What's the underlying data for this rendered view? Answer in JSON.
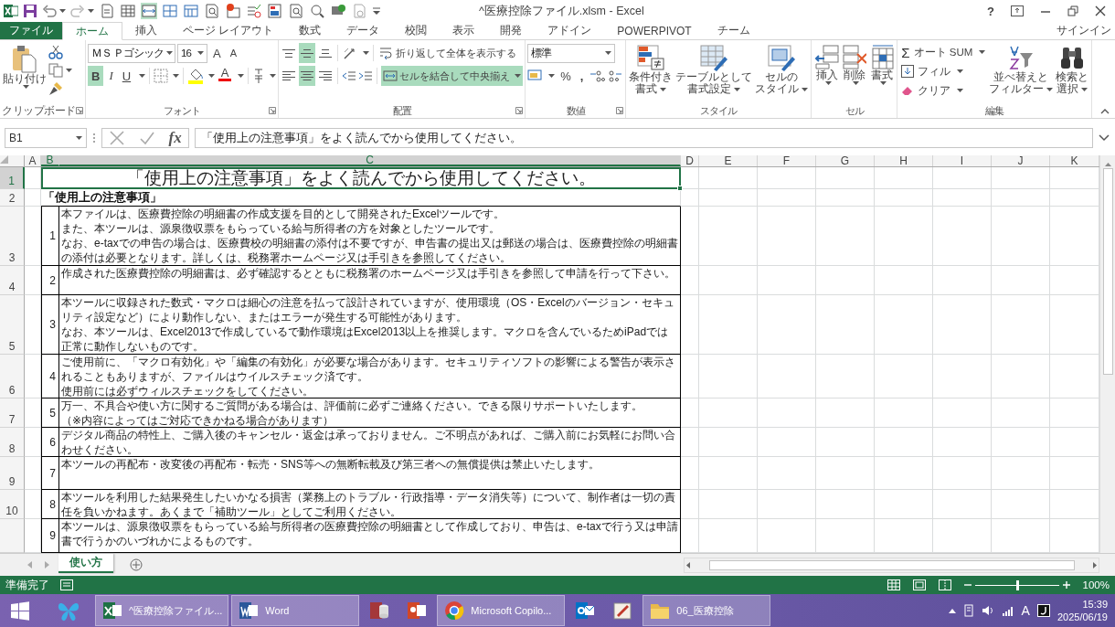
{
  "window": {
    "title": "^医療控除ファイル.xlsm - Excel",
    "help_label": "?"
  },
  "tabs": [
    {
      "label": "ファイル",
      "kind": "file",
      "selected": false
    },
    {
      "label": "ホーム",
      "kind": "tab",
      "selected": true
    },
    {
      "label": "挿入",
      "kind": "tab",
      "selected": false
    },
    {
      "label": "ページ レイアウト",
      "kind": "tab",
      "selected": false
    },
    {
      "label": "数式",
      "kind": "tab",
      "selected": false
    },
    {
      "label": "データ",
      "kind": "tab",
      "selected": false
    },
    {
      "label": "校閲",
      "kind": "tab",
      "selected": false
    },
    {
      "label": "表示",
      "kind": "tab",
      "selected": false
    },
    {
      "label": "開発",
      "kind": "tab",
      "selected": false
    },
    {
      "label": "アドイン",
      "kind": "tab",
      "selected": false
    },
    {
      "label": "POWERPIVOT",
      "kind": "tab",
      "selected": false
    },
    {
      "label": "チーム",
      "kind": "tab",
      "selected": false
    }
  ],
  "sign_in": "サインイン",
  "ribbon": {
    "clipboard": {
      "label": "クリップボード",
      "paste": "貼り付け"
    },
    "font": {
      "label": "フォント",
      "font_name": "ＭＳ Ｐゴシック",
      "font_size": "16",
      "grow_glyph": "A",
      "shrink_glyph": "A",
      "color_glyph": "A",
      "styles": [
        {
          "kind": "bold",
          "label": "B",
          "selected": true
        },
        {
          "kind": "italic",
          "label": "I",
          "selected": false
        },
        {
          "kind": "underline",
          "label": "U",
          "selected": false
        }
      ]
    },
    "alignment": {
      "label": "配置",
      "wrap": "折り返して全体を表示する",
      "merge": "セルを結合して中央揃え",
      "merge_selected": true,
      "vertical": [
        {
          "kind": "top",
          "selected": false
        },
        {
          "kind": "middle",
          "selected": true
        },
        {
          "kind": "bottom",
          "selected": false
        }
      ],
      "horizontal": [
        {
          "kind": "left",
          "selected": false
        },
        {
          "kind": "center",
          "selected": true
        },
        {
          "kind": "right",
          "selected": false
        }
      ]
    },
    "number": {
      "label": "数値",
      "format": "標準",
      "percent": "%",
      "comma": ","
    },
    "styles": {
      "label": "スタイル",
      "buttons": [
        {
          "kind": "conditional",
          "lines": [
            "条件付き",
            "書式"
          ]
        },
        {
          "kind": "table",
          "lines": [
            "テーブルとして",
            "書式設定"
          ]
        },
        {
          "kind": "cellstyle",
          "lines": [
            "セルの",
            "スタイル"
          ]
        }
      ]
    },
    "cells": {
      "label": "セル",
      "buttons": [
        {
          "kind": "insert",
          "label": "挿入"
        },
        {
          "kind": "delete",
          "label": "削除"
        },
        {
          "kind": "format",
          "label": "書式"
        }
      ]
    },
    "editing": {
      "label": "編集",
      "sigma": "Σ",
      "autosum": "オート SUM",
      "fill": "フィル",
      "clear": "クリア",
      "sort": [
        "並べ替えと",
        "フィルター"
      ],
      "find": [
        "検索と",
        "選択"
      ]
    }
  },
  "formula_bar": {
    "name_box": "B1",
    "fx": "fx",
    "formula": "「使用上の注意事項」をよく読んでから使用してください。"
  },
  "columns": [
    {
      "label": "A",
      "selected": false
    },
    {
      "label": "B",
      "selected": true
    },
    {
      "label": "C",
      "selected": true
    },
    {
      "label": "D",
      "selected": false
    },
    {
      "label": "E",
      "selected": false
    },
    {
      "label": "F",
      "selected": false
    },
    {
      "label": "G",
      "selected": false
    },
    {
      "label": "H",
      "selected": false
    },
    {
      "label": "I",
      "selected": false
    },
    {
      "label": "J",
      "selected": false
    },
    {
      "label": "K",
      "selected": false
    }
  ],
  "rows": [
    {
      "number": "1",
      "selected": true
    },
    {
      "number": "2",
      "selected": false
    },
    {
      "number": "3",
      "selected": false
    },
    {
      "number": "4",
      "selected": false
    },
    {
      "number": "5",
      "selected": false
    },
    {
      "number": "6",
      "selected": false
    },
    {
      "number": "7",
      "selected": false
    },
    {
      "number": "8",
      "selected": false
    },
    {
      "number": "9",
      "selected": false
    },
    {
      "number": "10",
      "selected": false
    }
  ],
  "sheet": {
    "title": "「使用上の注意事項」をよく読んでから使用してください。",
    "heading": "「使用上の注意事項」",
    "items": [
      {
        "no": "1",
        "paragraphs": [
          "本ファイルは、医療費控除の明細書の作成支援を目的として開発されたExcelツールです。",
          "また、本ツールは、源泉徴収票をもらっている給与所得者の方を対象としたツールです。",
          "なお、e-taxでの申告の場合は、医療費校の明細書の添付は不要ですが、申告書の提出又は郵送の場合は、医療費控除の明細書の添付は必要となります。詳しくは、税務署ホームページ又は手引きを参照してください。"
        ]
      },
      {
        "no": "2",
        "paragraphs": [
          "作成された医療費控除の明細書は、必ず確認するとともに税務署のホームページ又は手引きを参照して申請を行って下さい。"
        ]
      },
      {
        "no": "3",
        "paragraphs": [
          "本ツールに収録された数式・マクロは細心の注意を払って設計されていますが、使用環境（OS・Excelのバージョン・セキュリティ設定など）により動作しない、またはエラーが発生する可能性があります。",
          "なお、本ツールは、Excel2013で作成しているで動作環境はExcel2013以上を推奨します。マクロを含んでいるためiPadでは正常に動作しないものです。"
        ]
      },
      {
        "no": "4",
        "paragraphs": [
          "ご使用前に、「マクロ有効化」や「編集の有効化」が必要な場合があります。セキュリティソフトの影響による警告が表示されることもありますが、ファイルはウイルスチェック済です。",
          "使用前には必ずウィルスチェックをしてください。"
        ]
      },
      {
        "no": "5",
        "paragraphs": [
          "万一、不具合や使い方に関するご質問がある場合は、評価前に必ずご連絡ください。できる限りサポートいたします。",
          "（※内容によってはご対応できかねる場合があります）"
        ]
      },
      {
        "no": "6",
        "paragraphs": [
          "デジタル商品の特性上、ご購入後のキャンセル・返金は承っておりません。ご不明点があれば、ご購入前にお気軽にお問い合わせください。"
        ]
      },
      {
        "no": "7",
        "paragraphs": [
          "本ツールの再配布・改変後の再配布・転売・SNS等への無断転載及び第三者への無償提供は禁止いたします。"
        ]
      },
      {
        "no": "8",
        "paragraphs": [
          "本ツールを利用した結果発生したいかなる損害（業務上のトラブル・行政指導・データ消失等）について、制作者は一切の責任を負いかねます。あくまで「補助ツール」としてご利用ください。"
        ]
      },
      {
        "no": "9",
        "paragraphs": [
          "本ツールは、源泉徴収票をもらっている給与所得者の医療費控除の明細書として作成しており、申告は、e-taxで行う又は申請書で行うかのいづれかによるものです。"
        ]
      }
    ]
  },
  "sheet_tabs": [
    {
      "label": "使い方",
      "selected": true
    }
  ],
  "status_bar": {
    "status": "準備完了",
    "zoom": "100%",
    "zoom_slider": {
      "level": 0.5
    }
  },
  "taskbar": {
    "items": [
      {
        "kind": "excel",
        "label": "^医療控除ファイル...",
        "open": true
      },
      {
        "kind": "word",
        "label": "Word",
        "open": true
      },
      {
        "kind": "access",
        "open": false
      },
      {
        "kind": "powerpoint",
        "open": false
      },
      {
        "kind": "chrome",
        "label": "Microsoft Copilo...",
        "open": true
      },
      {
        "kind": "outlook",
        "open": false
      },
      {
        "kind": "paint",
        "open": false
      },
      {
        "kind": "folder",
        "label": "06_医療控除",
        "open": true
      }
    ],
    "ime": "A",
    "time": "15:39",
    "date": "2025/06/19"
  }
}
